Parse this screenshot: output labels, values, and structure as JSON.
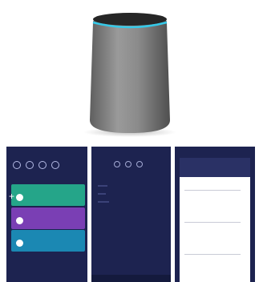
{
  "product": {
    "name": "smart-speaker",
    "body_color": "#8a8a8a",
    "ring_color": "#35c9e8"
  },
  "screens": [
    {
      "name": "home",
      "background": "#1d2350",
      "cards": [
        {
          "color": "#25a589"
        },
        {
          "color": "#7a3fb4"
        },
        {
          "color": "#1b88b3"
        }
      ]
    },
    {
      "name": "menu",
      "background": "#1d2350"
    },
    {
      "name": "details",
      "background": "#1d2350",
      "panel": "#ffffff"
    }
  ]
}
